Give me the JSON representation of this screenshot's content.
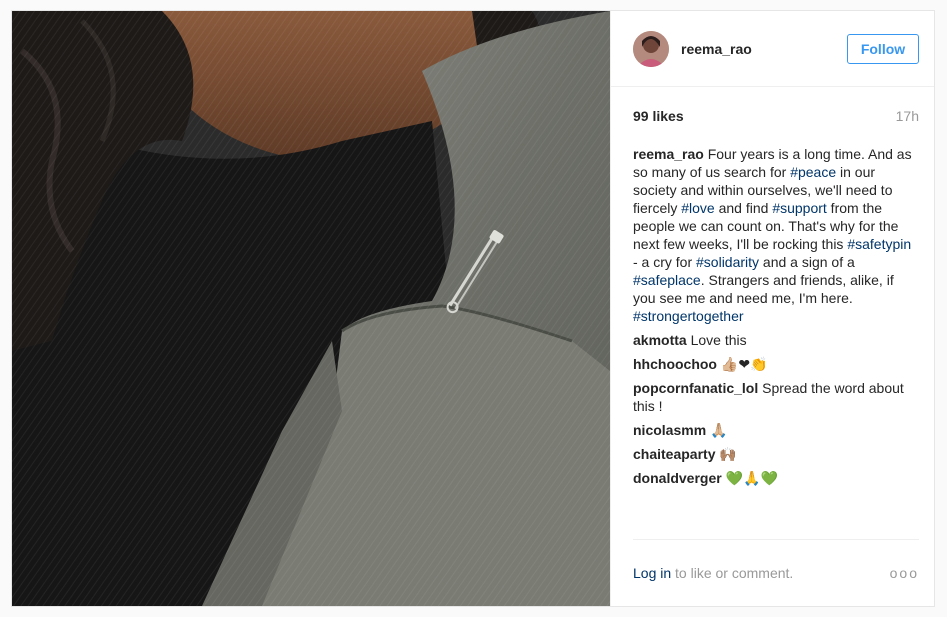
{
  "post": {
    "username": "reema_rao",
    "follow_label": "Follow",
    "likes": "99 likes",
    "time": "17h",
    "caption": {
      "author": "reema_rao",
      "segments": [
        {
          "text": "Four years is a long time. And as so many of us search for "
        },
        {
          "text": "#peace",
          "tag": true
        },
        {
          "text": " in our society and within ourselves, we'll need to fiercely "
        },
        {
          "text": "#love",
          "tag": true
        },
        {
          "text": " and find "
        },
        {
          "text": "#support",
          "tag": true
        },
        {
          "text": " from the people we can count on. That's why for the next few weeks, I'll be rocking this "
        },
        {
          "text": "#safetypin",
          "tag": true
        },
        {
          "text": " - a cry for "
        },
        {
          "text": "#solidarity",
          "tag": true
        },
        {
          "text": " and a sign of a "
        },
        {
          "text": "#safeplace",
          "tag": true
        },
        {
          "text": ". Strangers and friends, alike, if you see me and need me, I'm here. "
        },
        {
          "text": "#strongertogether",
          "tag": true
        }
      ]
    },
    "comments": [
      {
        "author": "akmotta",
        "text": "Love this"
      },
      {
        "author": "hhchoochoo",
        "text": "👍🏼❤👏"
      },
      {
        "author": "popcornfanatic_lol",
        "text": "Spread the word about this !"
      },
      {
        "author": "nicolasmm",
        "text": "🙏🏼"
      },
      {
        "author": "chaiteaparty",
        "text": "🙌🏽"
      },
      {
        "author": "donaldverger",
        "text": "💚🙏💚"
      }
    ],
    "footer": {
      "login_label": "Log in",
      "rest_label": "to like or comment.",
      "more_label": "ooo"
    }
  },
  "colors": {
    "accent": "#3897f0",
    "tag": "#003569",
    "muted": "#999999"
  },
  "icons": [
    "more-options-icon"
  ]
}
